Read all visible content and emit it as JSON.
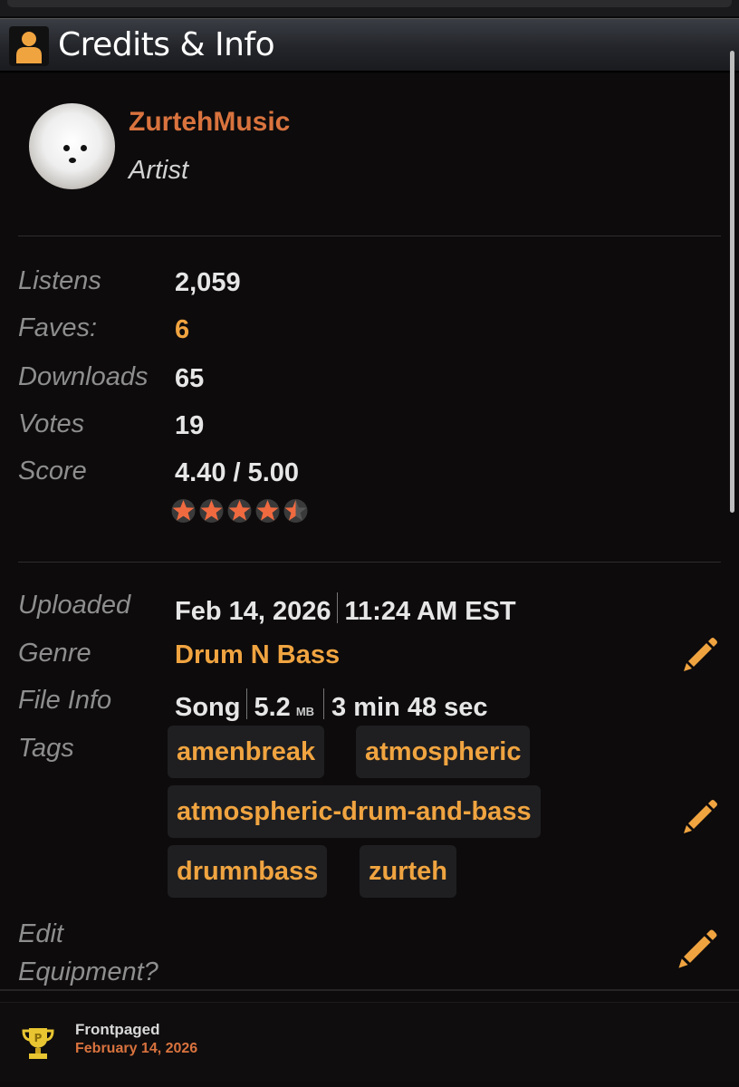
{
  "panel": {
    "title": "Credits & Info",
    "title_icon": "user-icon"
  },
  "artist": {
    "name": "ZurtehMusic",
    "role": "Artist"
  },
  "stats": {
    "listens_label": "Listens",
    "listens": "2,059",
    "faves_label": "Faves:",
    "faves": "6",
    "downloads_label": "Downloads",
    "downloads": "65",
    "votes_label": "Votes",
    "votes": "19",
    "score_label": "Score",
    "score": "4.40 / 5.00",
    "rating_stars": 4.5
  },
  "info": {
    "uploaded_label": "Uploaded",
    "uploaded_date": "Feb 14, 2026",
    "uploaded_time": "11:24 AM EST",
    "genre_label": "Genre",
    "genre": "Drum N Bass",
    "fileinfo_label": "File Info",
    "file_type": "Song",
    "file_size": "5.2",
    "file_size_unit": "MB",
    "duration": "3 min 48 sec",
    "tags_label": "Tags",
    "tags": [
      "amenbreak",
      "atmospheric",
      "atmospheric-drum-and-bass",
      "drumnbass",
      "zurteh"
    ],
    "equipment_label_line1": "Edit",
    "equipment_label_line2": "Equipment?"
  },
  "footer": {
    "award": "Frontpaged",
    "award_date": "February 14, 2026",
    "award_icon": "trophy-icon"
  },
  "colors": {
    "accent_orange": "#f0a440",
    "name_orange": "#d9733e",
    "background": "#0d0b0c"
  }
}
